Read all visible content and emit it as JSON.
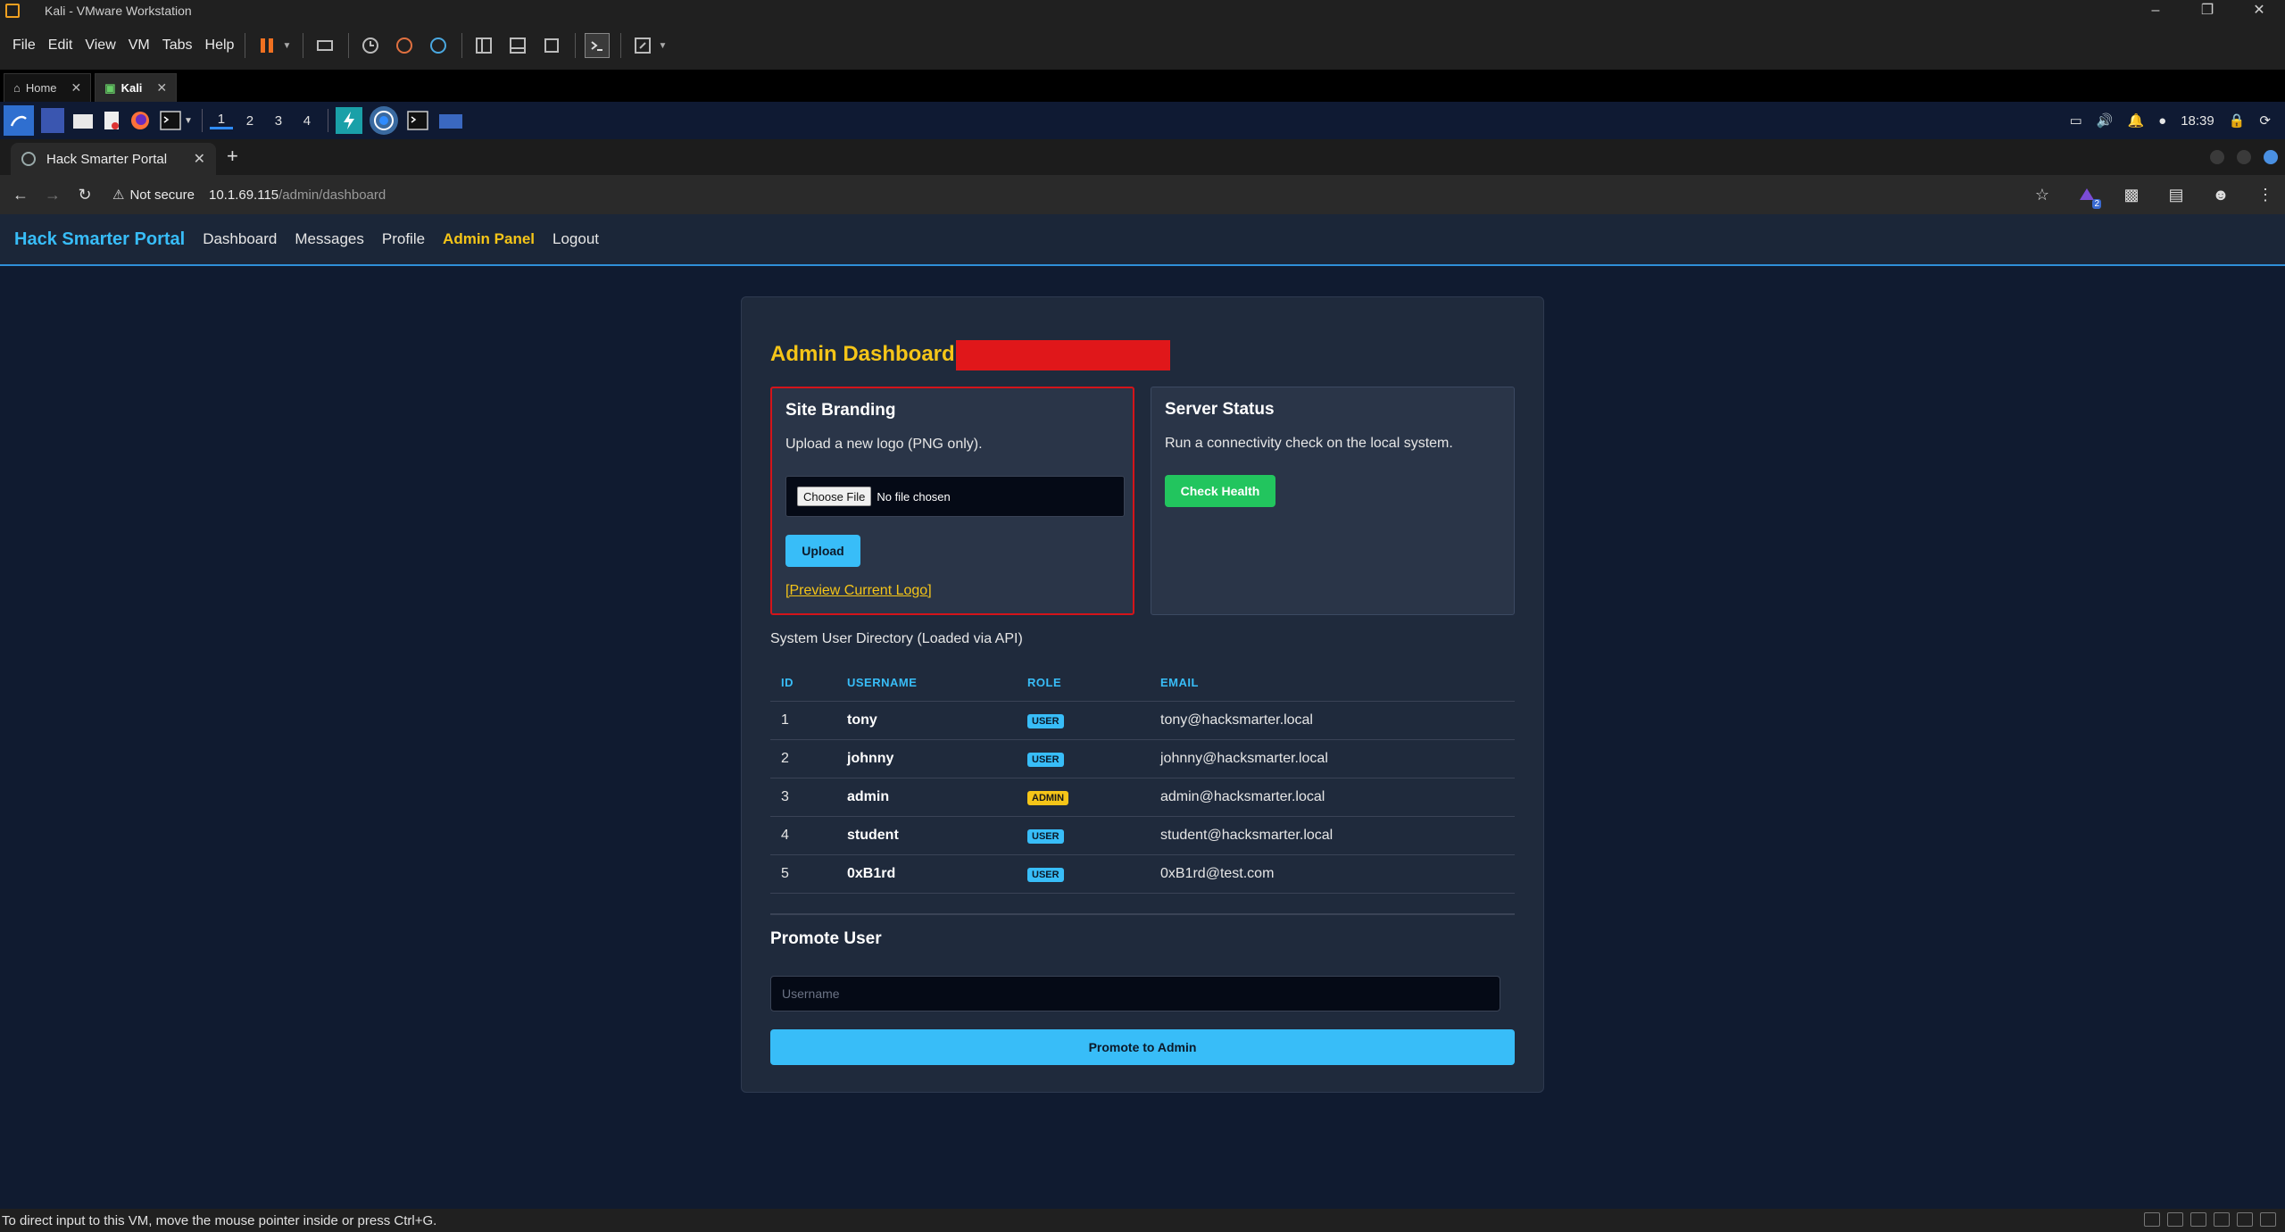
{
  "vmware": {
    "title": "Kali - VMware Workstation",
    "menu": [
      "File",
      "Edit",
      "View",
      "VM",
      "Tabs",
      "Help"
    ],
    "tabs": [
      {
        "label": "Home"
      },
      {
        "label": "Kali"
      }
    ],
    "status_message": "To direct input to this VM, move the mouse pointer inside or press Ctrl+G."
  },
  "kali_panel": {
    "workspaces": [
      "1",
      "2",
      "3",
      "4"
    ],
    "clock": "18:39"
  },
  "browser": {
    "tab_title": "Hack Smarter Portal",
    "not_secure": "Not secure",
    "url_host": "10.1.69.115",
    "url_path": "/admin/dashboard",
    "extension_badge": "2"
  },
  "site": {
    "brand": "Hack Smarter Portal",
    "nav": [
      "Dashboard",
      "Messages",
      "Profile",
      "Admin Panel",
      "Logout"
    ],
    "page_title": "Admin Dashboard",
    "branding": {
      "title": "Site Branding",
      "desc": "Upload a new logo (PNG only).",
      "choose_file": "Choose File",
      "no_file": "No file chosen",
      "upload": "Upload",
      "preview": "[Preview Current Logo]"
    },
    "server_status": {
      "title": "Server Status",
      "desc": "Run a connectivity check on the local system.",
      "button": "Check Health"
    },
    "directory_title": "System User Directory (Loaded via API)",
    "table": {
      "headers": [
        "ID",
        "USERNAME",
        "ROLE",
        "EMAIL"
      ],
      "rows": [
        {
          "id": "1",
          "username": "tony",
          "role": "USER",
          "email": "tony@hacksmarter.local"
        },
        {
          "id": "2",
          "username": "johnny",
          "role": "USER",
          "email": "johnny@hacksmarter.local"
        },
        {
          "id": "3",
          "username": "admin",
          "role": "ADMIN",
          "email": "admin@hacksmarter.local"
        },
        {
          "id": "4",
          "username": "student",
          "role": "USER",
          "email": "student@hacksmarter.local"
        },
        {
          "id": "5",
          "username": "0xB1rd",
          "role": "USER",
          "email": "0xB1rd@test.com"
        }
      ]
    },
    "promote": {
      "title": "Promote User",
      "placeholder": "Username",
      "button": "Promote to Admin"
    }
  },
  "colors": {
    "accent_blue": "#38bdf8",
    "accent_yellow": "#f5c518",
    "success_green": "#22c55e",
    "redaction_red": "#e0171a",
    "page_bg": "#101b30"
  }
}
